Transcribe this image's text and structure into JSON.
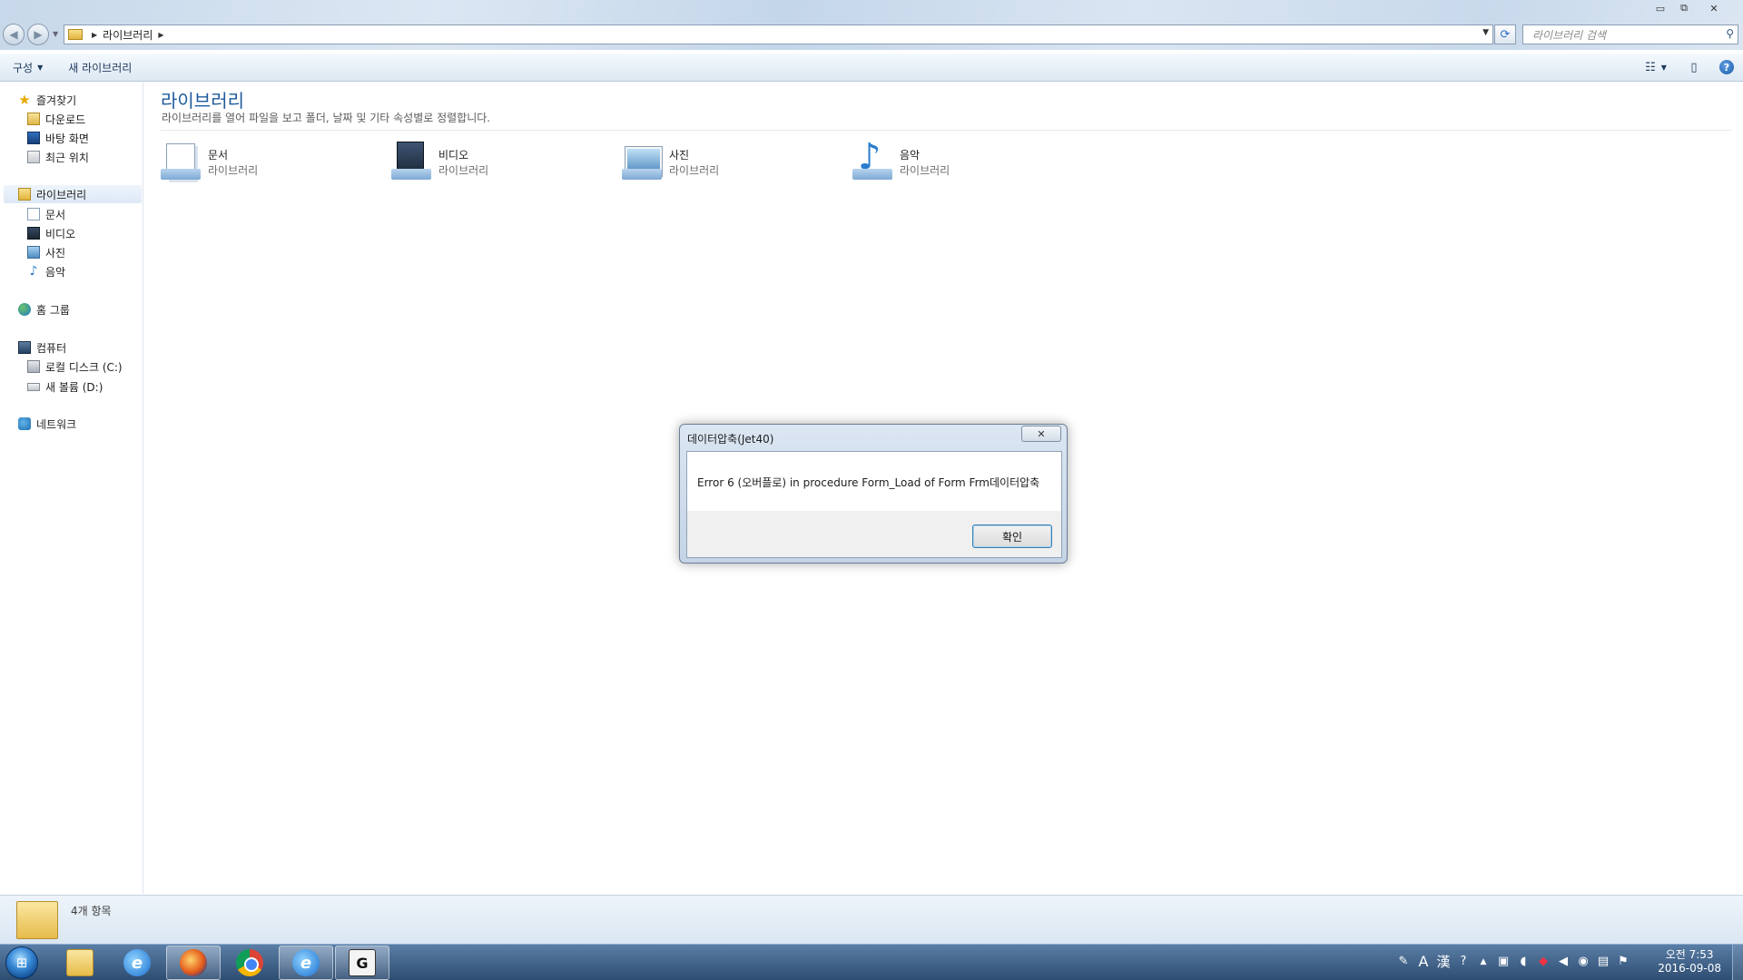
{
  "window": {
    "address": {
      "crumb": "라이브러리"
    },
    "search_placeholder": "라이브러리 검색",
    "controls": {
      "minimize": "▭",
      "maximize": "⧉",
      "close": "✕"
    }
  },
  "toolbar": {
    "organize": "구성",
    "new_library": "새 라이브러리"
  },
  "nav": {
    "favorites": "즐겨찾기",
    "downloads": "다운로드",
    "desktop": "바탕 화면",
    "recent": "최근 위치",
    "libraries": "라이브러리",
    "documents": "문서",
    "videos": "비디오",
    "pictures": "사진",
    "music": "음악",
    "homegroup": "홈 그룹",
    "computer": "컴퓨터",
    "local_disk": "로컬 디스크 (C:)",
    "new_volume": "새 볼륨 (D:)",
    "network": "네트워크"
  },
  "content": {
    "title": "라이브러리",
    "subtitle": "라이브러리를 열어 파일을 보고 폴더, 날짜 및 기타 속성별로 정렬합니다.",
    "tiles": [
      {
        "name": "문서",
        "type": "라이브러리"
      },
      {
        "name": "비디오",
        "type": "라이브러리"
      },
      {
        "name": "사진",
        "type": "라이브러리"
      },
      {
        "name": "음악",
        "type": "라이브러리"
      }
    ]
  },
  "details": {
    "count": "4개 항목"
  },
  "dialog": {
    "title": "데이터압축(Jet40)",
    "message": "Error 6 (오버플로) in procedure Form_Load of Form Frm데이터압축",
    "ok": "확인"
  },
  "taskbar": {
    "tray_lang_a": "A",
    "tray_lang_han": "漢",
    "clock_time": "오전 7:53",
    "clock_date": "2016-09-08"
  },
  "colors": {
    "accent_title": "#1e5b9c",
    "taskbar": "#2e4d72",
    "dialog_border": "#6c7f95"
  }
}
